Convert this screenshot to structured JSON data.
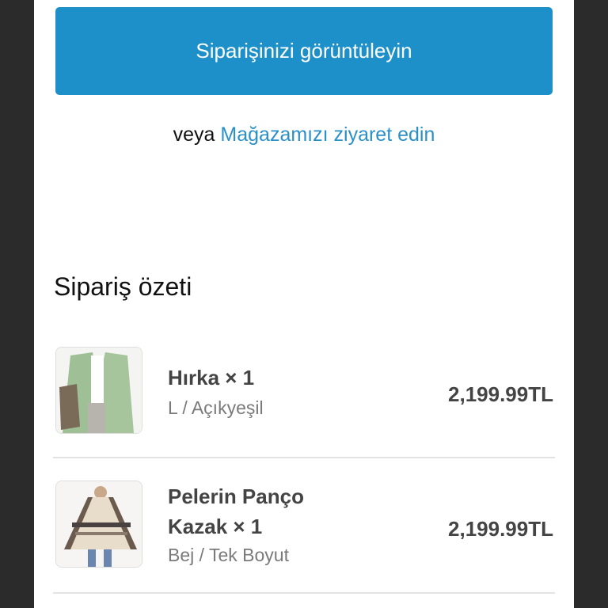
{
  "actions": {
    "view_order_label": "Siparişinizi görüntüleyin",
    "or_text": "veya",
    "visit_store_link": "Mağazamızı ziyaret edin"
  },
  "summary": {
    "title": "Sipariş özeti",
    "items": [
      {
        "name": "Hırka × 1",
        "variant": "L / Açıkyeşil",
        "price": "2,199.99TL",
        "image_icon": "green-cardigan-photo"
      },
      {
        "name": "Pelerin Panço Kazak × 1",
        "variant": "Bej / Tek Boyut",
        "price": "2,199.99TL",
        "image_icon": "plaid-poncho-photo"
      }
    ]
  },
  "colors": {
    "primary_button": "#1e90c9",
    "link": "#2b90c8",
    "background_frame": "#2b2b2b"
  }
}
